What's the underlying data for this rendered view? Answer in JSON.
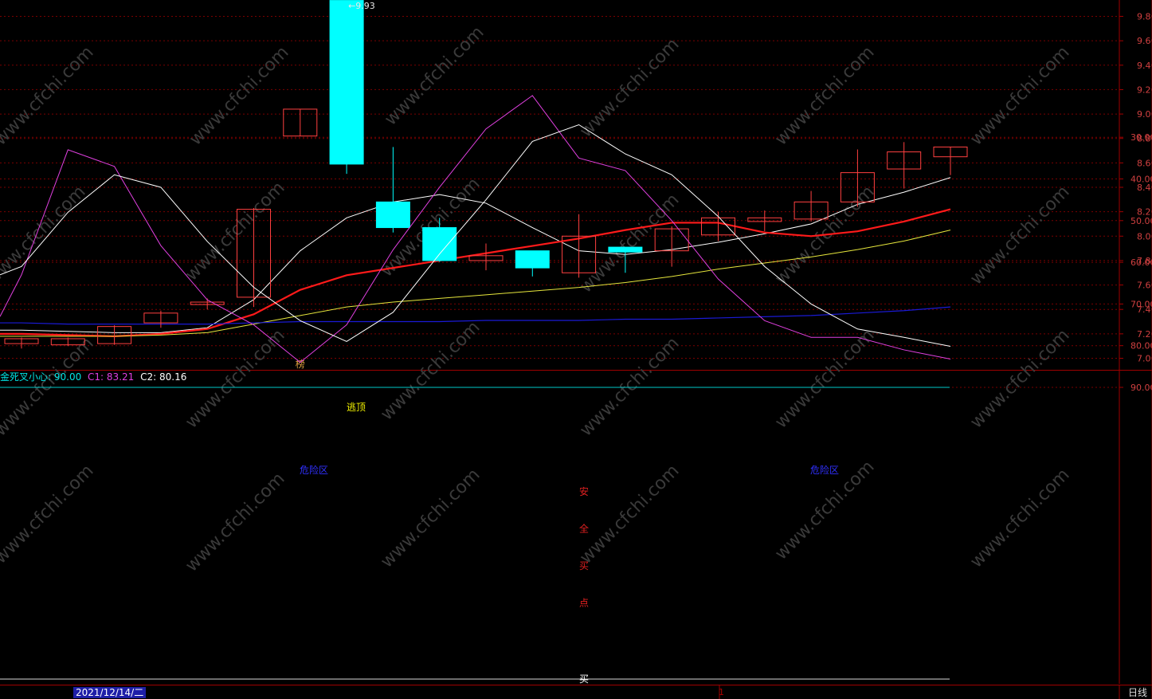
{
  "colors": {
    "background": "#000000",
    "grid": "#7a0000",
    "axis": "#a00000",
    "up_candle": "#ff4040",
    "down_candle": "#00ffff",
    "ma5": "#ffffff",
    "ma10": "#ff1a1a",
    "ma20": "#e6e63c",
    "ma60": "#1a1ad6",
    "k_line": "#ffffff",
    "d_line": "#e040e0",
    "watermark": "#3a3a3a"
  },
  "watermark": "www.cfchi.com",
  "price_panel": {
    "max_label": "9.93",
    "marker_label": "榜",
    "y_ticks": [
      "9.80",
      "9.60",
      "9.40",
      "9.20",
      "9.00",
      "8.80",
      "8.60",
      "8.40",
      "8.20",
      "8.00",
      "7.80",
      "7.60",
      "7.40",
      "7.20",
      "7.00"
    ]
  },
  "indicator_panel": {
    "title": "金死叉小心: 90.00",
    "c1": "C1: 83.21",
    "c2": "C2: 80.16",
    "y_ticks": [
      "90.00",
      "80.00",
      "70.00",
      "60.00",
      "50.00",
      "40.00",
      "30.00"
    ],
    "labels": {
      "top_escape": "逃顶",
      "dead_zone_left": "危险区",
      "dead_zone_right": "危险区",
      "safe_buy_chars": [
        "安",
        "全",
        "买",
        "点"
      ],
      "buy": "买"
    }
  },
  "bottom": {
    "date": "2021/12/14/二",
    "tick": "1",
    "period": "日线"
  },
  "chart_data": [
    {
      "type": "candlestick",
      "ylim": [
        6.96,
        9.9
      ],
      "candles": [
        {
          "o": 7.12,
          "c": 7.16,
          "h": 7.17,
          "l": 7.08
        },
        {
          "o": 7.11,
          "c": 7.16,
          "h": 7.17,
          "l": 7.1
        },
        {
          "o": 7.12,
          "c": 7.26,
          "h": 7.27,
          "l": 7.11
        },
        {
          "o": 7.29,
          "c": 7.37,
          "h": 7.39,
          "l": 7.25
        },
        {
          "o": 7.44,
          "c": 7.46,
          "h": 7.49,
          "l": 7.4
        },
        {
          "o": 7.5,
          "c": 8.22,
          "h": 8.23,
          "l": 7.42
        },
        {
          "o": 8.82,
          "c": 9.04,
          "h": 9.04,
          "l": 8.82
        },
        {
          "o": 9.93,
          "c": 8.59,
          "h": 9.93,
          "l": 8.51
        },
        {
          "o": 8.28,
          "c": 8.07,
          "h": 8.73,
          "l": 8.03
        },
        {
          "o": 8.07,
          "c": 7.8,
          "h": 8.15,
          "l": 7.79
        },
        {
          "o": 7.8,
          "c": 7.84,
          "h": 7.94,
          "l": 7.72
        },
        {
          "o": 7.88,
          "c": 7.74,
          "h": 7.88,
          "l": 7.67
        },
        {
          "o": 7.7,
          "c": 8.0,
          "h": 8.18,
          "l": 7.66
        },
        {
          "o": 7.91,
          "c": 7.87,
          "h": 7.91,
          "l": 7.7
        },
        {
          "o": 7.88,
          "c": 8.06,
          "h": 8.08,
          "l": 7.75
        },
        {
          "o": 8.01,
          "c": 8.15,
          "h": 8.2,
          "l": 7.96
        },
        {
          "o": 8.12,
          "c": 8.15,
          "h": 8.21,
          "l": 8.04
        },
        {
          "o": 8.14,
          "c": 8.28,
          "h": 8.37,
          "l": 8.12
        },
        {
          "o": 8.28,
          "c": 8.52,
          "h": 8.71,
          "l": 8.24
        },
        {
          "o": 8.55,
          "c": 8.69,
          "h": 8.77,
          "l": 8.39
        },
        {
          "o": 8.65,
          "c": 8.73,
          "h": 8.73,
          "l": 8.5
        }
      ],
      "series": [
        {
          "key": "ma5",
          "values": [
            7.23,
            7.22,
            7.21,
            7.21,
            7.25,
            7.48,
            7.88,
            8.15,
            8.28,
            8.34,
            8.27,
            8.07,
            7.88,
            7.85,
            7.89,
            7.95,
            8.02,
            8.1,
            8.26,
            8.36,
            8.48
          ]
        },
        {
          "key": "ma10",
          "values": [
            7.2,
            7.19,
            7.18,
            7.2,
            7.24,
            7.36,
            7.56,
            7.68,
            7.74,
            7.8,
            7.86,
            7.92,
            7.98,
            8.05,
            8.11,
            8.11,
            8.03,
            8.0,
            8.04,
            8.12,
            8.22
          ]
        },
        {
          "key": "ma20",
          "values": [
            7.18,
            7.18,
            7.18,
            7.19,
            7.21,
            7.28,
            7.35,
            7.42,
            7.46,
            7.49,
            7.52,
            7.55,
            7.58,
            7.62,
            7.67,
            7.73,
            7.78,
            7.83,
            7.89,
            7.96,
            8.05
          ]
        },
        {
          "key": "ma60",
          "values": [
            7.29,
            7.28,
            7.28,
            7.28,
            7.28,
            7.29,
            7.3,
            7.3,
            7.3,
            7.3,
            7.31,
            7.31,
            7.31,
            7.32,
            7.32,
            7.33,
            7.34,
            7.35,
            7.37,
            7.39,
            7.42
          ]
        }
      ]
    },
    {
      "type": "line",
      "ylim": [
        20,
        95
      ],
      "series": [
        {
          "name": "C1",
          "key": "d_line",
          "values": [
            63,
            33,
            37,
            56,
            69,
            75,
            84,
            75,
            57,
            42,
            28,
            20,
            35,
            38,
            50,
            64,
            74,
            78,
            78,
            81,
            83.21
          ]
        },
        {
          "name": "C2",
          "key": "k_line",
          "values": [
            61,
            48,
            39,
            42,
            55,
            66,
            74,
            79,
            72,
            58,
            45,
            31,
            27,
            34,
            39,
            49,
            61,
            70,
            76,
            78,
            80.16
          ]
        }
      ],
      "reference_lines": [
        90,
        10
      ]
    }
  ]
}
